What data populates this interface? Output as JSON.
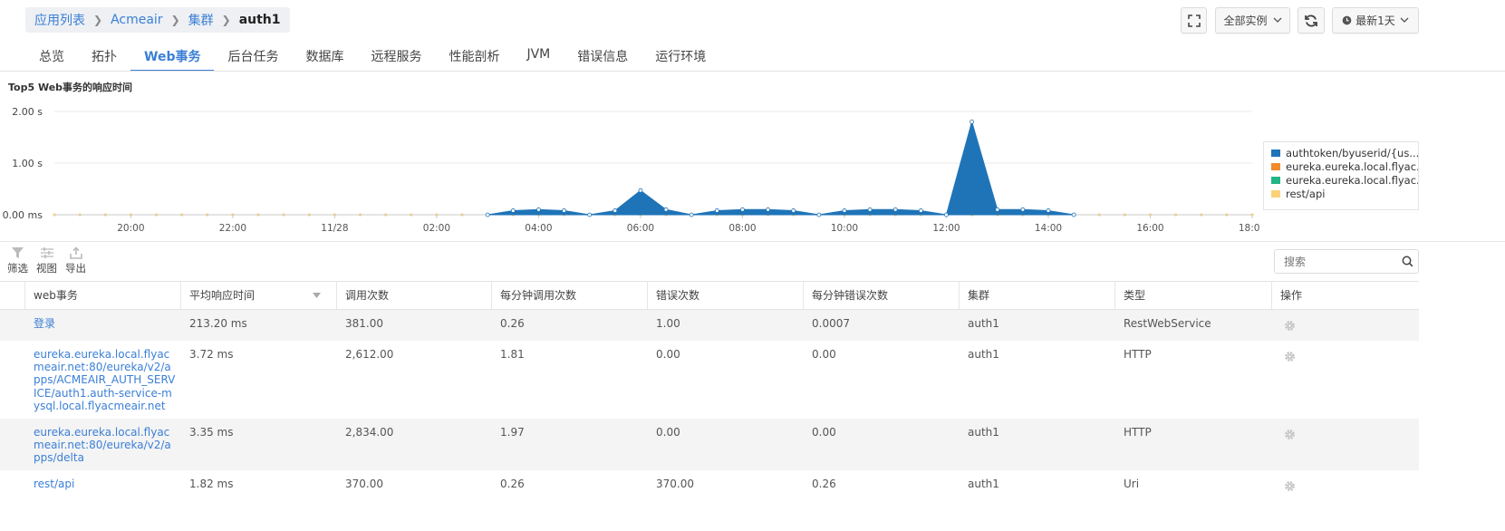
{
  "breadcrumb": {
    "items": [
      "应用列表",
      "Acmeair",
      "集群"
    ],
    "current": "auth1"
  },
  "topbar": {
    "instances_label": "全部实例",
    "time_label": "最新1天"
  },
  "tabs": [
    "总览",
    "拓扑",
    "Web事务",
    "后台任务",
    "数据库",
    "远程服务",
    "性能剖析",
    "JVM",
    "错误信息",
    "运行环境"
  ],
  "active_tab": "Web事务",
  "chart_data": {
    "type": "area",
    "title": "Top5 Web事务的响应时间",
    "y_unit": "s",
    "y_ticks": [
      "2.00 s",
      "1.00 s",
      "0.00 ms"
    ],
    "ylim": [
      0,
      2.0
    ],
    "x_ticks": [
      "20:00",
      "22:00",
      "11/28",
      "02:00",
      "04:00",
      "06:00",
      "08:00",
      "10:00",
      "12:00",
      "14:00",
      "16:00",
      "18:00"
    ],
    "grid": true,
    "legend_position": "right",
    "series": [
      {
        "name": "authtoken/byuserid/{us...",
        "color": "#1f74b8",
        "points": [
          [
            8.5,
            0
          ],
          [
            9.0,
            0.08
          ],
          [
            9.5,
            0.1
          ],
          [
            10.0,
            0.08
          ],
          [
            10.5,
            0
          ],
          [
            11.0,
            0.08
          ],
          [
            11.5,
            0.47
          ],
          [
            12.0,
            0.1
          ],
          [
            12.5,
            0
          ],
          [
            13.0,
            0.08
          ],
          [
            13.5,
            0.1
          ],
          [
            14.0,
            0.1
          ],
          [
            14.5,
            0.08
          ],
          [
            15.0,
            0
          ],
          [
            15.5,
            0.08
          ],
          [
            16.0,
            0.1
          ],
          [
            16.5,
            0.1
          ],
          [
            17.0,
            0.08
          ],
          [
            17.5,
            0
          ],
          [
            18.0,
            1.8
          ],
          [
            18.5,
            0.1
          ],
          [
            19.0,
            0.1
          ],
          [
            19.5,
            0.08
          ],
          [
            20.0,
            0
          ]
        ]
      },
      {
        "name": "eureka.eureka.local.flyac...",
        "color": "#f28a2e",
        "points": []
      },
      {
        "name": "eureka.eureka.local.flyac...",
        "color": "#22b585",
        "points": []
      },
      {
        "name": "rest/api",
        "color": "#fbd27a",
        "points": []
      }
    ]
  },
  "toolbar": {
    "filter_label": "筛选",
    "view_label": "视图",
    "export_label": "导出",
    "search_placeholder": "搜索"
  },
  "table": {
    "columns": [
      "web事务",
      "平均响应时间",
      "调用次数",
      "每分钟调用次数",
      "错误次数",
      "每分钟错误次数",
      "集群",
      "类型",
      "操作"
    ],
    "rows": [
      {
        "name": "登录",
        "avg": "213.20 ms",
        "calls": "381.00",
        "cpm": "0.26",
        "errors": "1.00",
        "epm": "0.0007",
        "cluster": "auth1",
        "type": "RestWebService"
      },
      {
        "name": "eureka.eureka.local.flyacmeair.net:80/eureka/v2/apps/ACMEAIR_AUTH_SERVICE/auth1.auth-service-mysql.local.flyacmeair.net",
        "avg": "3.72 ms",
        "calls": "2,612.00",
        "cpm": "1.81",
        "errors": "0.00",
        "epm": "0.00",
        "cluster": "auth1",
        "type": "HTTP"
      },
      {
        "name": "eureka.eureka.local.flyacmeair.net:80/eureka/v2/apps/delta",
        "avg": "3.35 ms",
        "calls": "2,834.00",
        "cpm": "1.97",
        "errors": "0.00",
        "epm": "0.00",
        "cluster": "auth1",
        "type": "HTTP"
      },
      {
        "name": "rest/api",
        "avg": "1.82 ms",
        "calls": "370.00",
        "cpm": "0.26",
        "errors": "370.00",
        "epm": "0.26",
        "cluster": "auth1",
        "type": "Uri"
      }
    ]
  }
}
